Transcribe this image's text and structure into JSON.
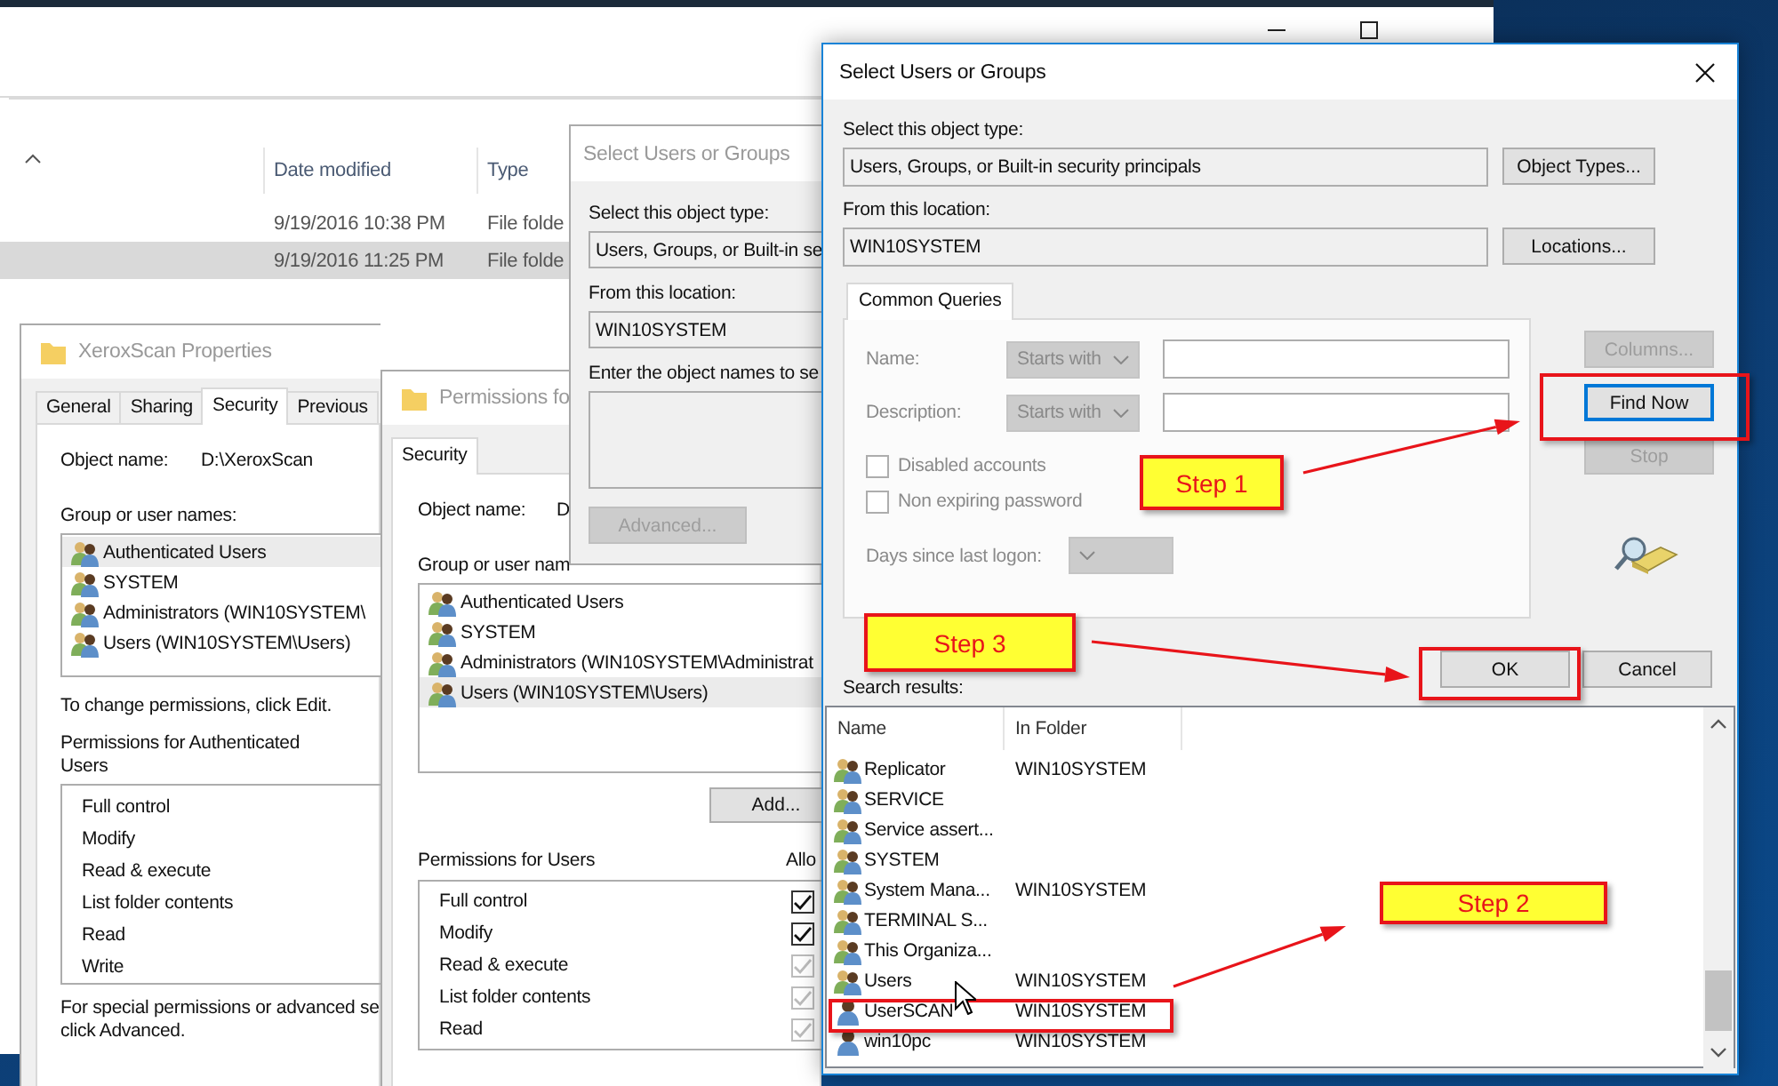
{
  "explorer": {
    "columns": [
      {
        "label": "Date modified"
      },
      {
        "label": "Type"
      }
    ],
    "rows": [
      {
        "date": "9/19/2016 10:38 PM",
        "type": "File folde",
        "selected": false
      },
      {
        "date": "9/19/2016 11:25 PM",
        "type": "File folde",
        "selected": true
      }
    ]
  },
  "properties": {
    "title": "XeroxScan Properties",
    "tabs": [
      {
        "label": "General",
        "selected": false
      },
      {
        "label": "Sharing",
        "selected": false
      },
      {
        "label": "Security",
        "selected": true
      },
      {
        "label": "Previous",
        "selected": false
      }
    ],
    "object_label": "Object name:",
    "object_name": "D:\\XeroxScan",
    "groups_label": "Group or user names:",
    "groups": [
      {
        "name": "Authenticated Users",
        "selected": true
      },
      {
        "name": "SYSTEM",
        "selected": false
      },
      {
        "name": "Administrators (WIN10SYSTEM\\",
        "selected": false
      },
      {
        "name": "Users (WIN10SYSTEM\\Users)",
        "selected": false
      }
    ],
    "change_hint": "To change permissions, click Edit.",
    "permissions_label": "Permissions for Authenticated Users",
    "permissions": [
      "Full control",
      "Modify",
      "Read & execute",
      "List folder contents",
      "Read",
      "Write"
    ],
    "advanced_hint_lines": [
      "For special permissions or advanced se",
      "click Advanced."
    ]
  },
  "permissions_window": {
    "title": "Permissions fo",
    "tabs": [
      {
        "label": "Security",
        "selected": true
      }
    ],
    "object_label": "Object name:",
    "object_name": "D",
    "groups_label": "Group or user nam",
    "groups": [
      {
        "name": "Authenticated Users",
        "selected": false
      },
      {
        "name": "SYSTEM",
        "selected": false
      },
      {
        "name": "Administrators (WIN10SYSTEM\\Administrat",
        "selected": false
      },
      {
        "name": "Users (WIN10SYSTEM\\Users)",
        "selected": true
      }
    ],
    "add_button": "Add...",
    "permissions_label": "Permissions for Users",
    "allow_label": "Allo",
    "permissions": [
      {
        "name": "Full control",
        "allow": true,
        "inherited": false
      },
      {
        "name": "Modify",
        "allow": true,
        "inherited": false
      },
      {
        "name": "Read & execute",
        "allow": true,
        "inherited": true
      },
      {
        "name": "List folder contents",
        "allow": true,
        "inherited": true
      },
      {
        "name": "Read",
        "allow": true,
        "inherited": true
      }
    ]
  },
  "back_dialog": {
    "title": "Select Users or Groups",
    "type_label": "Select this object type:",
    "type_value": "Users, Groups, or Built-in se",
    "location_label": "From this location:",
    "location_value": "WIN10SYSTEM",
    "names_label": "Enter the object names to se",
    "advanced_button": {
      "label": "Advanced...",
      "disabled": true
    }
  },
  "dialog": {
    "title": "Select Users or Groups",
    "type_label": "Select this object type:",
    "type_value": "Users, Groups, or Built-in security principals",
    "object_types_button": "Object Types...",
    "location_label": "From this location:",
    "location_value": "WIN10SYSTEM",
    "locations_button": "Locations...",
    "query_tab": "Common Queries",
    "name_label": "Name:",
    "name_mode": "Starts with",
    "description_label": "Description:",
    "description_mode": "Starts with",
    "checkboxes": [
      {
        "label": "Disabled accounts",
        "checked": false
      },
      {
        "label": "Non expiring password",
        "checked": false
      }
    ],
    "days_label": "Days since last logon:",
    "side_buttons": [
      {
        "label": "Columns...",
        "disabled": true,
        "default": false
      },
      {
        "label": "Find Now",
        "disabled": false,
        "default": true
      },
      {
        "label": "Stop",
        "disabled": true,
        "default": false
      }
    ],
    "ok_button": "OK",
    "cancel_button": "Cancel",
    "results_label": "Search results:",
    "columns": [
      {
        "label": "Name"
      },
      {
        "label": "In Folder"
      }
    ],
    "results": [
      {
        "name": "Replicator",
        "folder": "WIN10SYSTEM",
        "kind": "group",
        "selected": false
      },
      {
        "name": "SERVICE",
        "kind": "group",
        "selected": false
      },
      {
        "name": "Service assert...",
        "kind": "group",
        "selected": false
      },
      {
        "name": "SYSTEM",
        "kind": "group",
        "selected": false
      },
      {
        "name": "System Mana...",
        "folder": "WIN10SYSTEM",
        "kind": "group",
        "selected": false
      },
      {
        "name": "TERMINAL S...",
        "kind": "group",
        "selected": false
      },
      {
        "name": "This Organiza...",
        "kind": "group",
        "selected": false
      },
      {
        "name": "Users",
        "folder": "WIN10SYSTEM",
        "kind": "group",
        "selected": false
      },
      {
        "name": "UserSCAN",
        "folder": "WIN10SYSTEM",
        "kind": "user",
        "selected": false
      },
      {
        "name": "win10pc",
        "folder": "WIN10SYSTEM",
        "kind": "user",
        "selected": false
      }
    ]
  },
  "annotations": [
    {
      "text": "Step 1"
    },
    {
      "text": "Step 2"
    },
    {
      "text": "Step 3"
    }
  ]
}
